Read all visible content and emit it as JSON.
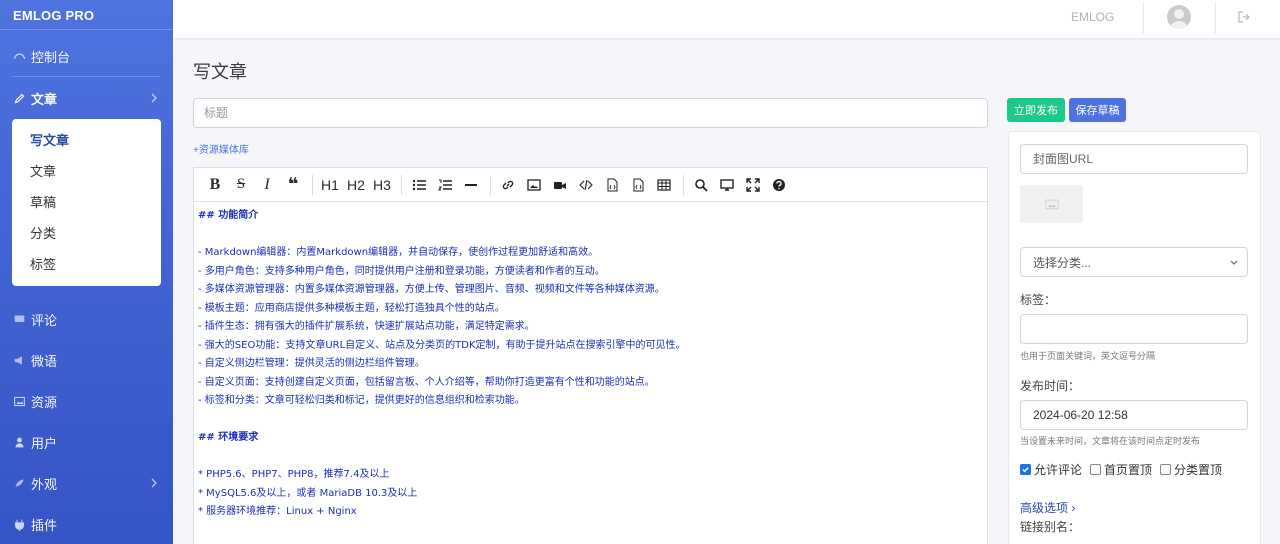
{
  "brand": "EMLOG PRO",
  "sidebar": {
    "items": [
      {
        "label": "控制台",
        "icon": "dashboard-icon"
      },
      {
        "label": "文章",
        "icon": "pencil-icon"
      },
      {
        "label": "评论",
        "icon": "comment-icon"
      },
      {
        "label": "微语",
        "icon": "megaphone-icon"
      },
      {
        "label": "资源",
        "icon": "image-icon"
      },
      {
        "label": "用户",
        "icon": "user-icon"
      },
      {
        "label": "外观",
        "icon": "palette-icon"
      },
      {
        "label": "插件",
        "icon": "plug-icon"
      }
    ],
    "submenu": [
      "写文章",
      "文章",
      "草稿",
      "分类",
      "标签"
    ]
  },
  "topbar": {
    "site_name": "EMLOG"
  },
  "main": {
    "page_title": "写文章",
    "title_placeholder": "标题",
    "media_link": "+资源媒体库",
    "toolbar": {
      "heading_buttons": [
        "H1",
        "H2",
        "H3"
      ],
      "icons": [
        "bold-icon",
        "strikethrough-icon",
        "italic-icon",
        "quote-icon",
        "h1",
        "h2",
        "h3",
        "unordered-list-icon",
        "ordered-list-icon",
        "horizontal-rule-icon",
        "link-icon",
        "image-icon",
        "video-icon",
        "code-icon",
        "code-block-icon",
        "preformatted-icon",
        "table-icon",
        "search-icon",
        "preview-icon",
        "fullscreen-icon",
        "help-icon"
      ]
    },
    "content_lines": [
      "## 功能简介",
      "",
      "- Markdown编辑器：内置Markdown编辑器，并自动保存，使创作过程更加舒适和高效。",
      "- 多用户角色：支持多种用户角色，同时提供用户注册和登录功能，方便读者和作者的互动。",
      "- 多媒体资源管理器：内置多媒体资源管理器，方便上传、管理图片、音频、视频和文件等各种媒体资源。",
      "- 模板主题：应用商店提供多种模板主题，轻松打造独具个性的站点。",
      "- 插件生态：拥有强大的插件扩展系统，快速扩展站点功能，满足特定需求。",
      "- 强大的SEO功能：支持文章URL自定义、站点及分类页的TDK定制，有助于提升站点在搜索引擎中的可见性。",
      "- 自定义侧边栏管理：提供灵活的侧边栏组件管理。",
      "- 自定义页面：支持创建自定义页面，包括留言板、个人介绍等，帮助你打造更富有个性和功能的站点。",
      "- 标签和分类：文章可轻松归类和标记，提供更好的信息组织和检索功能。",
      "",
      "## 环境要求",
      "",
      "* PHP5.6、PHP7、PHP8，推荐7.4及以上",
      "* MySQL5.6及以上，或者 MariaDB 10.3及以上",
      "* 服务器环境推荐：Linux + Nginx"
    ]
  },
  "panel": {
    "publish_label": "立即发布",
    "draft_label": "保存草稿",
    "cover_placeholder": "封面图URL",
    "category_select": "选择分类...",
    "tags_label": "标签：",
    "tags_hint": "也用于页面关键词，英文逗号分隔",
    "date_label": "发布时间：",
    "date_value": "2024-06-20 12:58",
    "date_hint": "当设置未来时间，文章将在该时间点定时发布",
    "checkboxes": [
      {
        "label": "允许评论",
        "checked": true
      },
      {
        "label": "首页置顶",
        "checked": false
      },
      {
        "label": "分类置顶",
        "checked": false
      }
    ],
    "advanced_label": "高级选项 ›",
    "alias_label": "链接别名："
  },
  "colors": {
    "sidebar": "#4e73df",
    "publish": "#1cc88a",
    "draft": "#4e73df",
    "editor_text": "#1c2fb8"
  }
}
